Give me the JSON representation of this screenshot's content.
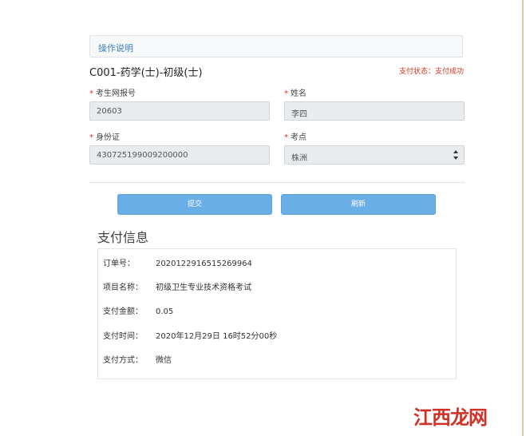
{
  "instructions_label": "操作说明",
  "exam_title": "C001-药学(士)-初级(士)",
  "payment_status": "支付状态：支付成功",
  "form": {
    "exam_reg_no": {
      "label": "考生网报号",
      "value": "20603"
    },
    "name": {
      "label": "姓名",
      "value": "李四"
    },
    "id_card": {
      "label": "身份证",
      "value": "430725199009200000"
    },
    "exam_site": {
      "label": "考点",
      "value": "株洲"
    }
  },
  "buttons": {
    "submit": "提交",
    "refresh": "刷新"
  },
  "payment_info": {
    "heading": "支付信息",
    "rows": [
      {
        "label": "订单号：",
        "value": "2020122916515269964"
      },
      {
        "label": "项目名称：",
        "value": "初级卫生专业技术资格考试"
      },
      {
        "label": "支付金额：",
        "value": "0.05"
      },
      {
        "label": "支付时间：",
        "value": "2020年12月29日 16时52分00秒"
      },
      {
        "label": "支付方式：",
        "value": "微信"
      }
    ]
  },
  "watermark": {
    "text": "江西龙网"
  },
  "colors": {
    "accent_blue": "#6aaee8",
    "status_red": "#d9321f",
    "link_blue": "#3a7fc1"
  }
}
